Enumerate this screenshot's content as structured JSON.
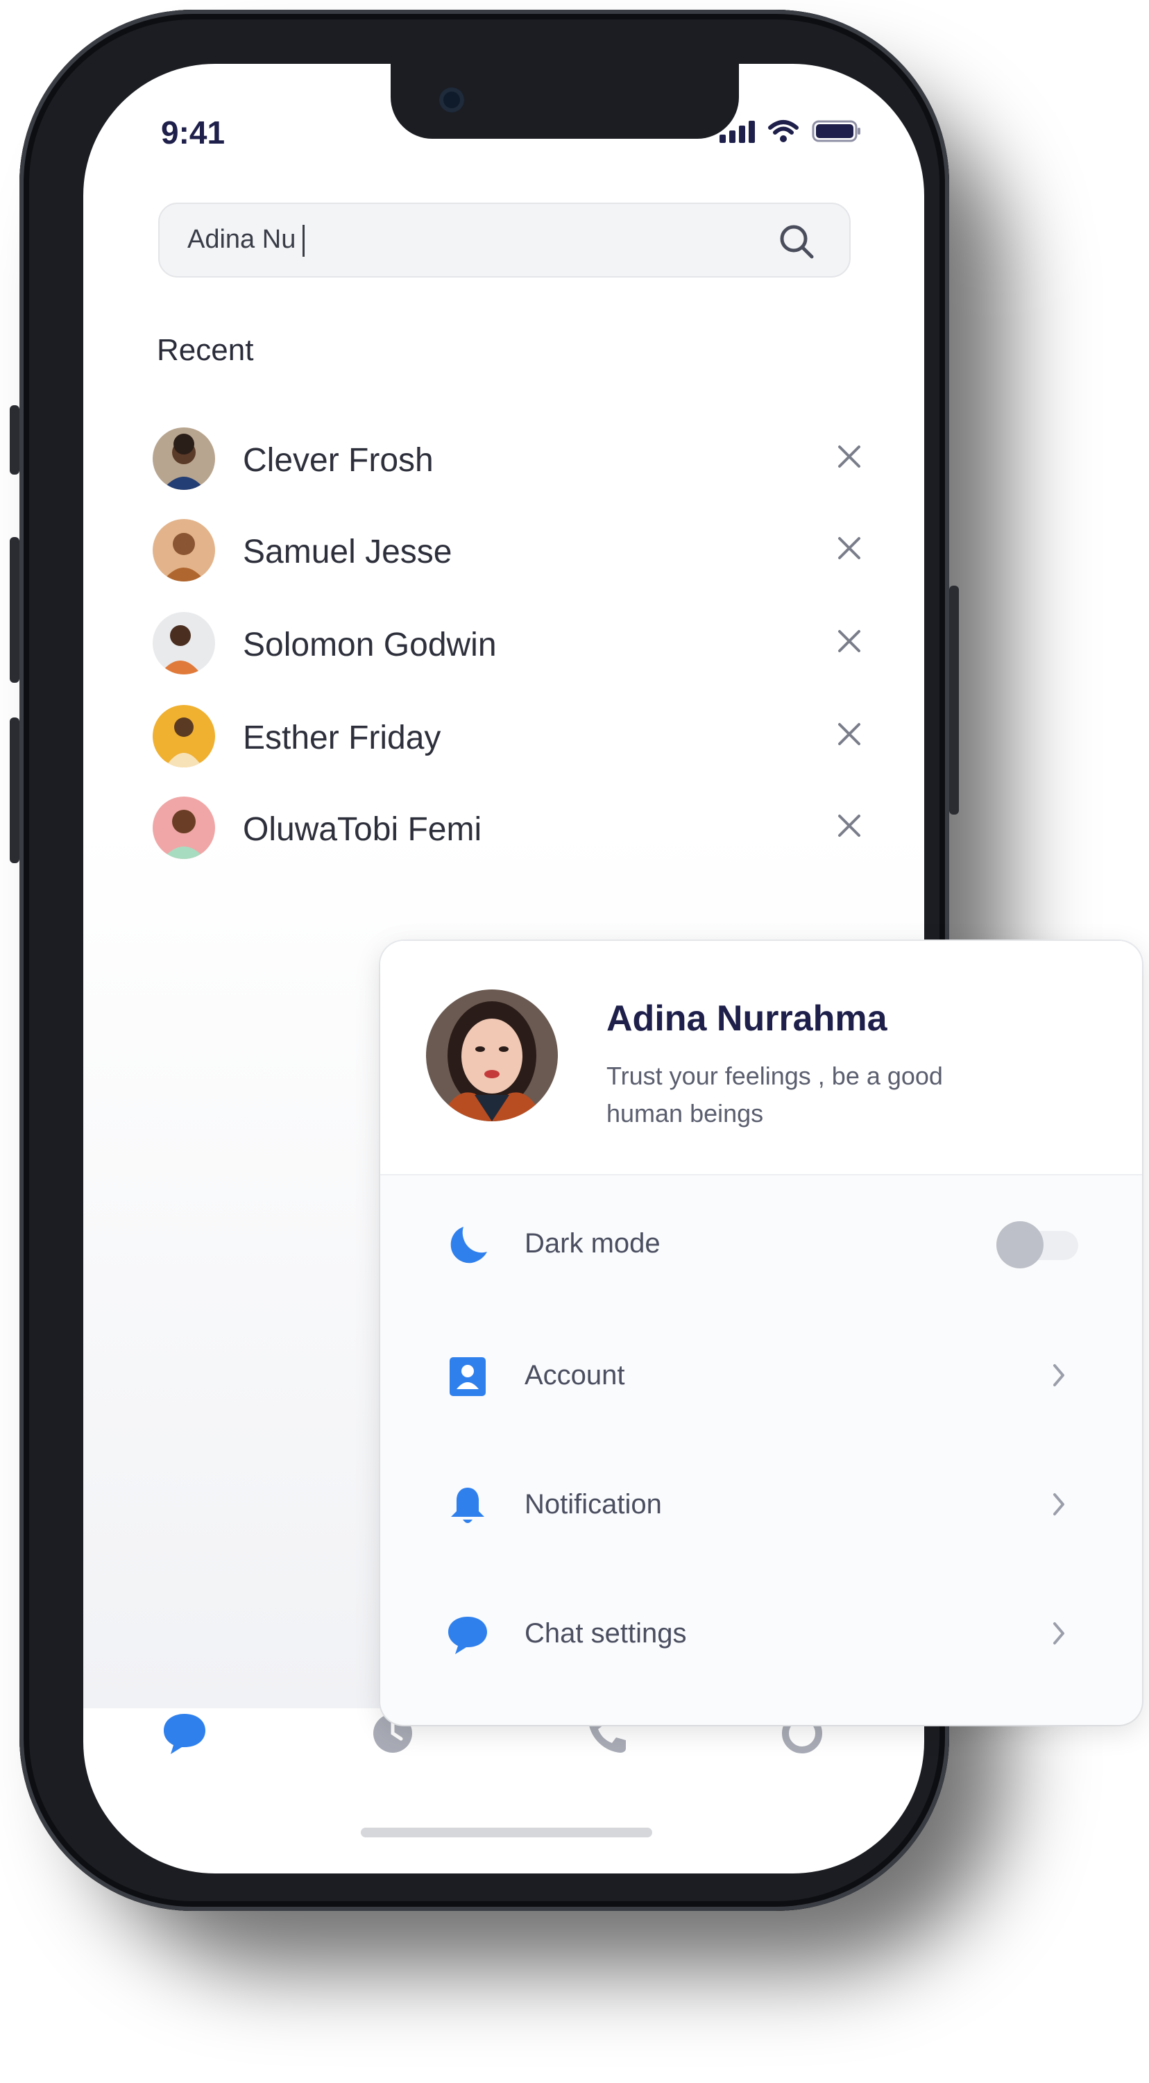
{
  "status_bar": {
    "time": "9:41"
  },
  "search": {
    "value": "Adina Nu"
  },
  "recent": {
    "title": "Recent",
    "contacts": [
      {
        "name": "Clever Frosh"
      },
      {
        "name": "Samuel Jesse"
      },
      {
        "name": "Solomon Godwin"
      },
      {
        "name": "Esther Friday"
      },
      {
        "name": "OluwaTobi Femi"
      }
    ]
  },
  "profile": {
    "name": "Adina Nurrahma",
    "bio": "Trust your feelings , be a good human beings"
  },
  "settings": {
    "dark_mode": {
      "label": "Dark mode",
      "enabled": false
    },
    "account": {
      "label": "Account"
    },
    "notification": {
      "label": "Notification"
    },
    "chat_settings": {
      "label": "Chat settings"
    }
  },
  "colors": {
    "accent": "#2f80ed",
    "heading": "#1e1f4a",
    "muted": "#5a5e6e"
  }
}
